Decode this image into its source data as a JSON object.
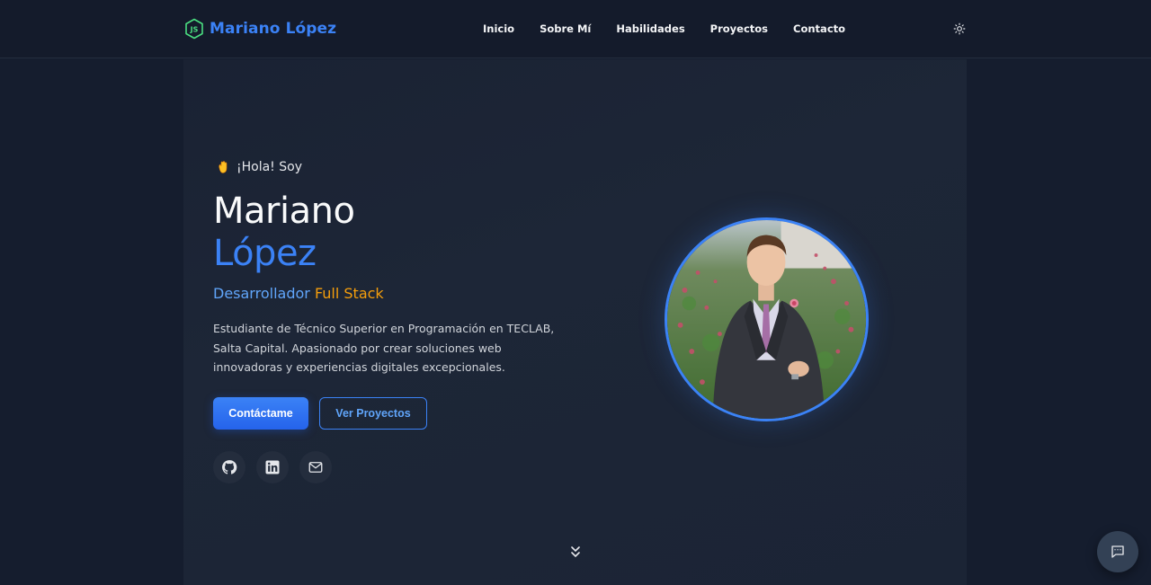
{
  "header": {
    "brand_name": "Mariano López",
    "nav": [
      {
        "label": "Inicio"
      },
      {
        "label": "Sobre Mí"
      },
      {
        "label": "Habilidades"
      },
      {
        "label": "Proyectos"
      },
      {
        "label": "Contacto"
      }
    ],
    "icons": {
      "brand": "nodejs-icon",
      "theme_toggle": "sun-icon"
    }
  },
  "hero": {
    "greeting": "¡Hola! Soy",
    "greeting_icon": "waving-hand-icon",
    "first_name": "Mariano",
    "last_name": "López",
    "role_part1": "Desarrollador",
    "role_part2": "Full Stack",
    "bio": "Estudiante de Técnico Superior en Programación en TECLAB, Salta Capital. Apasionado por crear soluciones web innovadoras y experiencias digitales excepcionales.",
    "primary_button": "Contáctame",
    "secondary_button": "Ver Proyectos",
    "socials": [
      {
        "icon": "github-icon"
      },
      {
        "icon": "linkedin-icon"
      },
      {
        "icon": "mail-icon"
      }
    ],
    "avatar_icon": "profile-photo",
    "scroll_icon": "chevrons-down-icon"
  },
  "chat": {
    "icon": "message-square-icon"
  },
  "colors": {
    "background": "#151d2e",
    "navbar": "#141b2b",
    "accent": "#3b82f6",
    "highlight": "#f59e0b",
    "text": "#f9fafb"
  }
}
